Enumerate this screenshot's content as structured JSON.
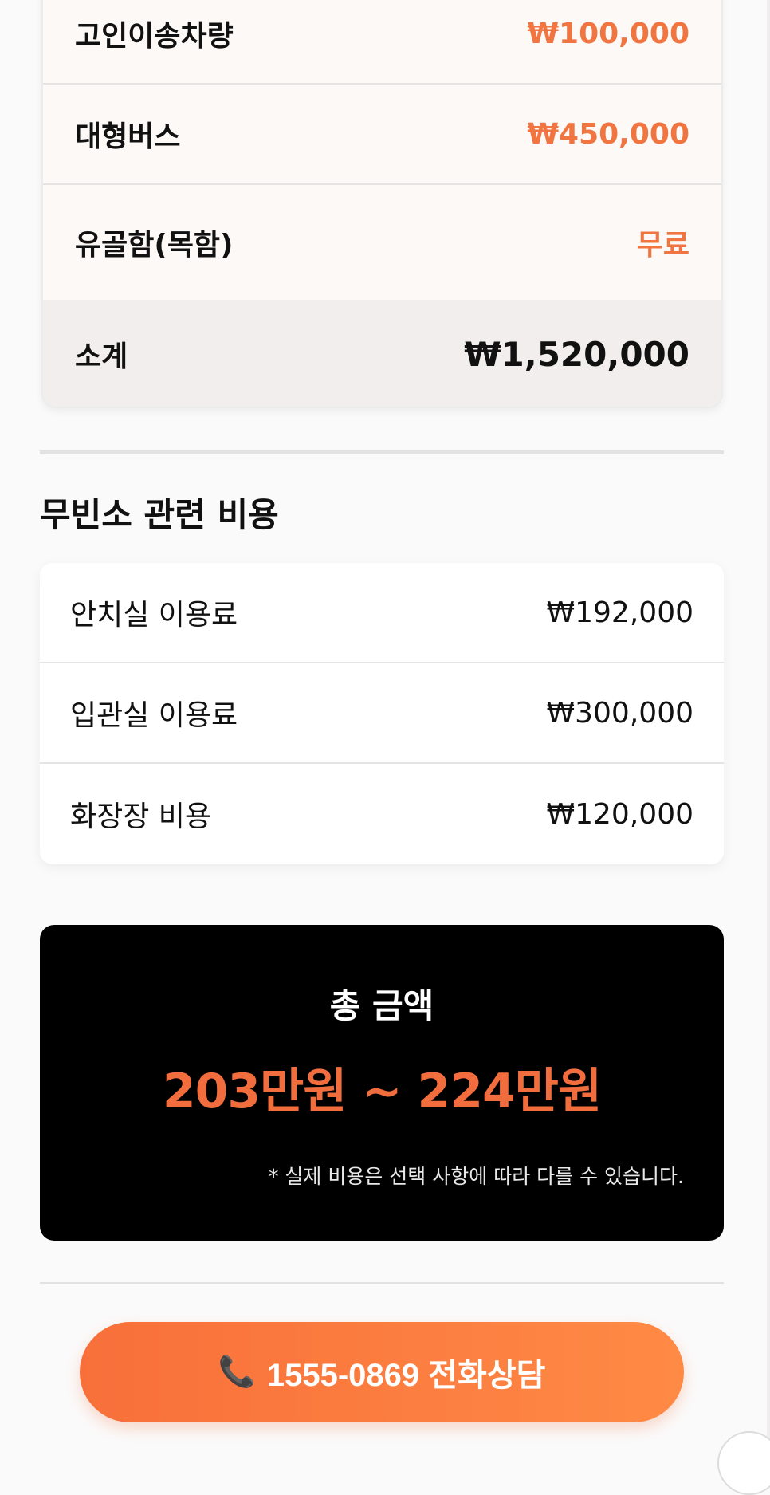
{
  "service_items": [
    {
      "label": "고인이송차량",
      "price": "₩100,000"
    },
    {
      "label": "대형버스",
      "price": "₩450,000"
    },
    {
      "label": "유골함(목함)",
      "price": "무료"
    }
  ],
  "subtotal": {
    "label": "소계",
    "amount": "₩1,520,000"
  },
  "facility_section": {
    "title": "무빈소 관련 비용",
    "items": [
      {
        "label": "안치실 이용료",
        "amount": "₩192,000"
      },
      {
        "label": "입관실 이용료",
        "amount": "₩300,000"
      },
      {
        "label": "화장장 비용",
        "amount": "₩120,000"
      }
    ]
  },
  "total": {
    "title": "총 금액",
    "range": "203만원 ~ 224만원",
    "note": "* 실제 비용은 선택 사항에 따라 다를 수 있습니다."
  },
  "call_button": {
    "icon": "📞",
    "label": "1555-0869 전화상담"
  },
  "colors": {
    "accent": "#f07541",
    "total_range": "#f26d3d",
    "total_bg": "#000000",
    "button_gradient_start": "#f86f3a",
    "button_gradient_end": "#ff8a45"
  }
}
